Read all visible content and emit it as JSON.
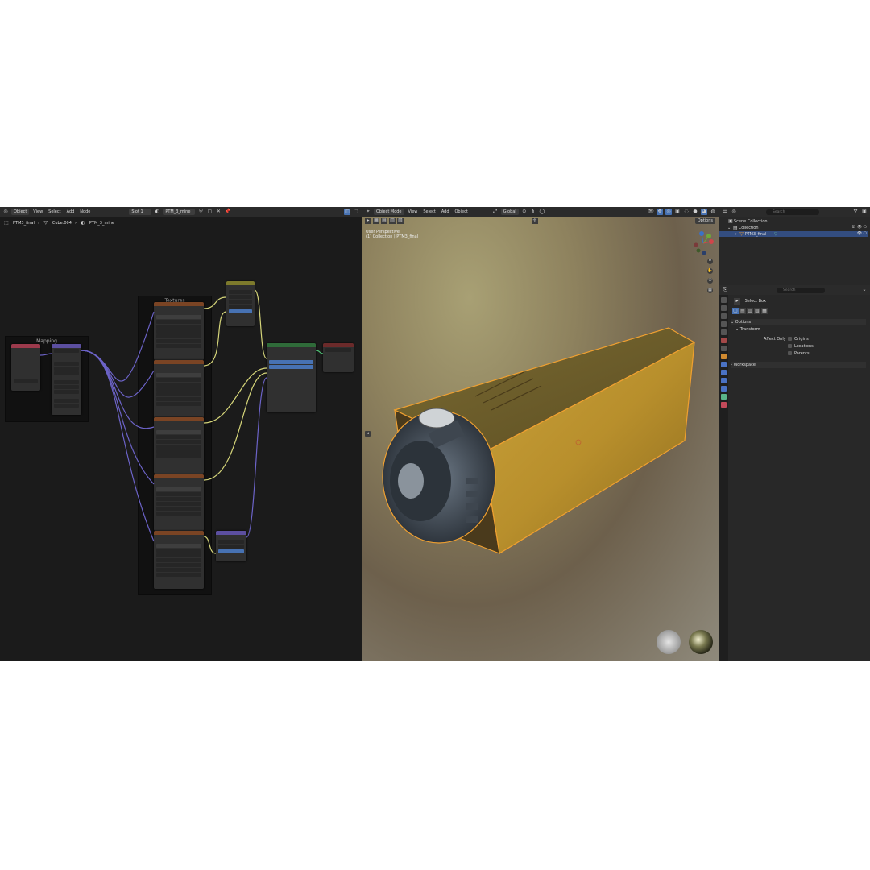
{
  "node_editor": {
    "header": {
      "mode": "Object",
      "menus": [
        "View",
        "Select",
        "Add",
        "Node"
      ],
      "slot": "Slot 1",
      "material": "PTM_3_mine"
    },
    "breadcrumb": [
      "PTM3_final",
      "Cube.004",
      "PTM_3_mine"
    ],
    "frames": {
      "mapping": "Mapping",
      "textures": "Textures"
    }
  },
  "viewport": {
    "header": {
      "mode": "Object Mode",
      "menus": [
        "View",
        "Select",
        "Add",
        "Object"
      ],
      "orientation": "Global"
    },
    "options_label": "Options",
    "hud": {
      "line1": "User Perspective",
      "line2": "(1) Collection | PTM3_final"
    },
    "gizmo": {
      "x": "X",
      "y": "Y",
      "z": "Z"
    }
  },
  "outliner": {
    "search_placeholder": "Search",
    "items": [
      {
        "label": "Scene Collection"
      },
      {
        "label": "Collection"
      },
      {
        "label": "PTM3_final"
      }
    ]
  },
  "properties": {
    "search_placeholder": "Search",
    "tool": "Select Box",
    "sections": {
      "options": "Options",
      "transform": "Transform",
      "affect_only": "Affect Only",
      "origins": "Origins",
      "locations": "Locations",
      "parents": "Parents",
      "workspace": "Workspace"
    }
  },
  "colors": {
    "accent": "#4772b3",
    "selection_outline": "#f0a030",
    "texture_node_header": "#7a4424",
    "bsdf_header": "#2f6b39",
    "output_header": "#6b2a2a",
    "vector_header": "#5c4fa0",
    "coord_header": "#9c3a4c",
    "mix_header": "#7d7a2c"
  }
}
